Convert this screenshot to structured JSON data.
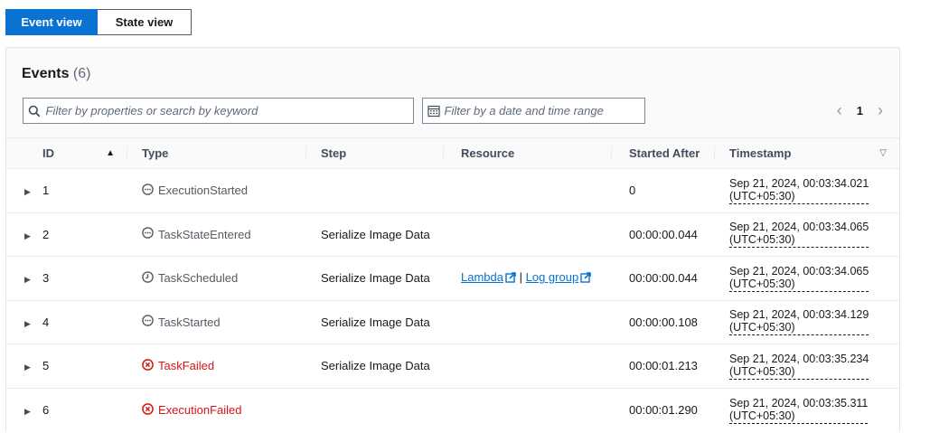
{
  "view_toggle": {
    "event_view": "Event view",
    "state_view": "State view"
  },
  "panel": {
    "title": "Events",
    "count": "(6)"
  },
  "filters": {
    "search_placeholder": "Filter by properties or search by keyword",
    "date_placeholder": "Filter by a date and time range"
  },
  "pagination": {
    "current_page": "1"
  },
  "columns": {
    "id": "ID",
    "type": "Type",
    "step": "Step",
    "resource": "Resource",
    "started_after": "Started After",
    "timestamp": "Timestamp"
  },
  "resource_links": {
    "lambda": "Lambda",
    "separator": "|",
    "log_group": "Log group"
  },
  "rows": [
    {
      "id": "1",
      "type": "ExecutionStarted",
      "status": "info",
      "step": "",
      "started_after": "0",
      "timestamp": "Sep 21, 2024, 00:03:34.021",
      "tz": "(UTC+05:30)"
    },
    {
      "id": "2",
      "type": "TaskStateEntered",
      "status": "info",
      "step": "Serialize Image Data",
      "started_after": "00:00:00.044",
      "timestamp": "Sep 21, 2024, 00:03:34.065",
      "tz": "(UTC+05:30)"
    },
    {
      "id": "3",
      "type": "TaskScheduled",
      "status": "pending",
      "step": "Serialize Image Data",
      "started_after": "00:00:00.044",
      "timestamp": "Sep 21, 2024, 00:03:34.065",
      "tz": "(UTC+05:30)"
    },
    {
      "id": "4",
      "type": "TaskStarted",
      "status": "info",
      "step": "Serialize Image Data",
      "started_after": "00:00:00.108",
      "timestamp": "Sep 21, 2024, 00:03:34.129",
      "tz": "(UTC+05:30)"
    },
    {
      "id": "5",
      "type": "TaskFailed",
      "status": "failed",
      "step": "Serialize Image Data",
      "started_after": "00:00:01.213",
      "timestamp": "Sep 21, 2024, 00:03:35.234",
      "tz": "(UTC+05:30)"
    },
    {
      "id": "6",
      "type": "ExecutionFailed",
      "status": "failed",
      "step": "",
      "started_after": "00:00:01.290",
      "timestamp": "Sep 21, 2024, 00:03:35.311",
      "tz": "(UTC+05:30)"
    }
  ],
  "colors": {
    "primary": "#0972d3",
    "error": "#d91515",
    "text": "#16191f",
    "muted": "#545b64"
  }
}
